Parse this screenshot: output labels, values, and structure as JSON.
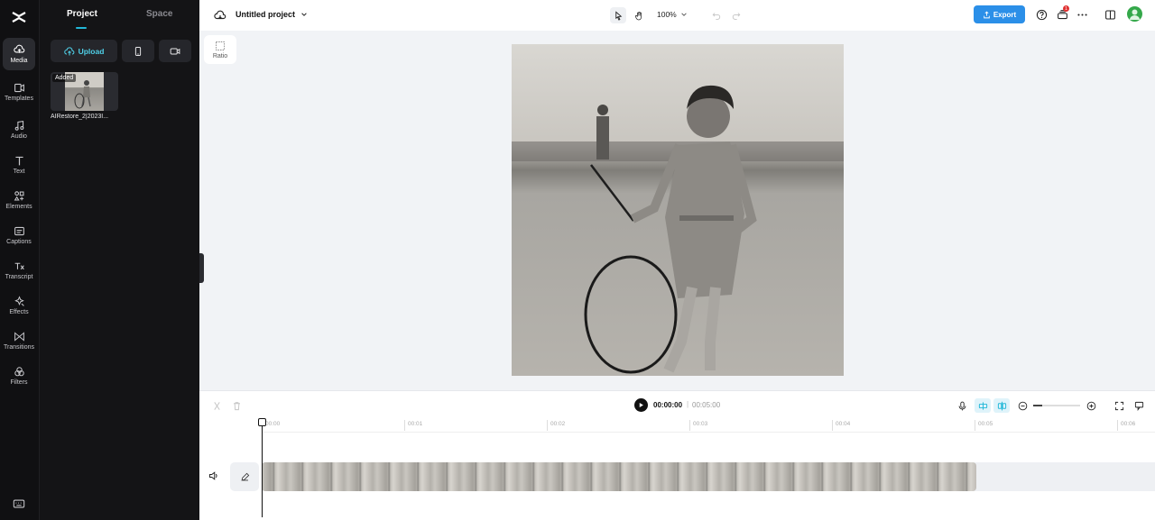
{
  "sidebar": {
    "items": [
      {
        "label": "Media",
        "icon": "media-icon"
      },
      {
        "label": "Templates",
        "icon": "templates-icon"
      },
      {
        "label": "Audio",
        "icon": "audio-icon"
      },
      {
        "label": "Text",
        "icon": "text-icon"
      },
      {
        "label": "Elements",
        "icon": "elements-icon"
      },
      {
        "label": "Captions",
        "icon": "captions-icon"
      },
      {
        "label": "Transcript",
        "icon": "transcript-icon"
      },
      {
        "label": "Effects",
        "icon": "effects-icon"
      },
      {
        "label": "Transitions",
        "icon": "transitions-icon"
      },
      {
        "label": "Filters",
        "icon": "filters-icon"
      }
    ],
    "active": "Media"
  },
  "panel": {
    "tabs": [
      "Project",
      "Space"
    ],
    "active_tab": "Project",
    "upload_label": "Upload",
    "media": [
      {
        "name": "AIRestore_2|2023I...",
        "badge": "Added"
      }
    ]
  },
  "header": {
    "project_title": "Untitled project",
    "zoom": "100%",
    "export_label": "Export",
    "notification_count": "1"
  },
  "canvas": {
    "ratio_label": "Ratio"
  },
  "timeline": {
    "current_time": "00:00:00",
    "separator": "|",
    "total_time": "00:05:00",
    "ruler_ticks": [
      "00:00",
      "00:01",
      "00:02",
      "00:03",
      "00:04",
      "00:05",
      "00:06"
    ]
  },
  "colors": {
    "accent": "#22b8d8",
    "export": "#2b8fe8",
    "rail_bg": "#101012",
    "panel_bg": "#141416"
  }
}
